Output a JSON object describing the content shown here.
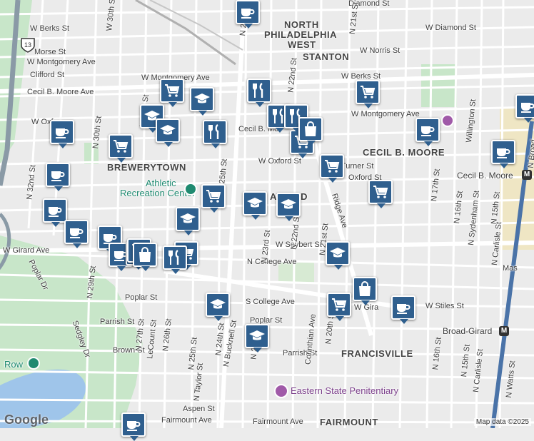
{
  "neighborhoods": [
    "NORTH",
    "PHILADELPHIA",
    "WEST",
    "STANTON",
    "BREWERYTOWN",
    "CECIL B. MOORE",
    "FRANCISVILLE",
    "FAIRMOUNT",
    "AWOOD"
  ],
  "landmarks": {
    "athletic_line1": "Athletic",
    "athletic_line2": "Recreation Center",
    "eastern_state": "Eastern State Penitentiary",
    "cecil_station": "Cecil B. Moore",
    "broad_girard": "Broad-Girard",
    "row": "Row"
  },
  "streets": {
    "w_diamond": "W Diamond St",
    "w_diamond_top": "Diamond St",
    "w_berks": "W Berks St",
    "w_berks_right": "W Berks St",
    "morse": "Morse St",
    "w_montgomery": "W Montgomery Ave",
    "w_montgomery_right": "W Montgomery Ave",
    "clifford": "Clifford St",
    "w_norris": "W Norris St",
    "cecil_moore_ave": "Cecil B. Moore Ave",
    "cecil_short": "Cecil B. Mo",
    "w_oxford": "W Oxford St",
    "w_oxford_left": "W Oxf",
    "turner": "Turner St",
    "oxford_right": "Oxford St",
    "w_girard": "W Girard Ave",
    "w_girard_right": "W Gira",
    "n_college": "N College Ave",
    "s_college": "S College Ave",
    "poplar_left": "Poplar St",
    "poplar_mid": "Poplar St",
    "poplar_dr": "Poplar Dr",
    "parrish_left": "Parrish St",
    "parrish_mid": "Parrish St",
    "brown": "Brown St",
    "aspen": "Aspen St",
    "fairmount_left": "Fairmount Ave",
    "fairmount_right": "Fairmount Ave",
    "w_seybert": "W Seybert St",
    "w_stiles": "W Stiles St",
    "sedgley": "Sedgley Dr",
    "ridge": "Ridge Ave",
    "corinthian": "Corinthian Ave",
    "n_25th": "N 25th St",
    "n_25th_b": "N 25th St",
    "n_24th": "N 24th St",
    "n_23rd": "N 23rd St",
    "n_22nd": "N 22nd St",
    "n_22nd_b": "N 22nd St",
    "n_22nd_c": "N 22nd St",
    "n_21st": "N 21st St",
    "n_20th": "N 20th St",
    "n_30th": "N 30th St",
    "n_29th": "N 29th St",
    "n_27th": "N 27th St",
    "n_26th": "N 26th St",
    "n_32nd": "N 32nd St",
    "n_17th": "N 17th St",
    "n_16th": "N 16th St",
    "n_16th_b": "N 16th St",
    "n_15th": "N 15th St",
    "n_15th_b": "N 15th St",
    "n_sydenham": "N Sydenham St",
    "n_carlisle": "N Carlisle St",
    "n_carlisle_b": "N Carlisle St",
    "n_watts": "N Watts St",
    "n_broad": "N Broad",
    "n_bucknell": "N Bucknell St",
    "n_taylor": "N Taylor St",
    "lecount": "LeCount St",
    "willington": "Willington St",
    "n_21st_top": "N 21st St",
    "n_25th_top": "N 25th St",
    "n_30th_top": "W 30th St",
    "n_29th_top": "N 29th St",
    "mas": "Mas"
  },
  "shield_number": "13",
  "attribution": {
    "google": "Google",
    "map_data": "Map data ©2025"
  },
  "markers": [
    {
      "type": "cafe"
    },
    {
      "type": "cafe"
    },
    {
      "type": "cafe"
    },
    {
      "type": "cafe"
    },
    {
      "type": "cafe"
    },
    {
      "type": "cafe"
    },
    {
      "type": "cafe"
    },
    {
      "type": "cafe"
    },
    {
      "type": "cafe"
    },
    {
      "type": "cafe"
    },
    {
      "type": "cafe"
    },
    {
      "type": "cafe"
    },
    {
      "type": "school"
    },
    {
      "type": "school"
    },
    {
      "type": "school"
    },
    {
      "type": "school"
    },
    {
      "type": "school"
    },
    {
      "type": "school"
    },
    {
      "type": "school"
    },
    {
      "type": "school"
    },
    {
      "type": "school"
    },
    {
      "type": "school"
    },
    {
      "type": "grocery"
    },
    {
      "type": "grocery"
    },
    {
      "type": "grocery"
    },
    {
      "type": "grocery"
    },
    {
      "type": "grocery"
    },
    {
      "type": "grocery"
    },
    {
      "type": "grocery"
    },
    {
      "type": "grocery"
    },
    {
      "type": "grocery"
    },
    {
      "type": "grocery"
    },
    {
      "type": "restaurant"
    },
    {
      "type": "restaurant"
    },
    {
      "type": "restaurant"
    },
    {
      "type": "restaurant"
    },
    {
      "type": "restaurant"
    },
    {
      "type": "shopping"
    },
    {
      "type": "shopping"
    },
    {
      "type": "shopping"
    }
  ],
  "colors": {
    "marker": "#2f5f8e",
    "park": "#c8e6c9",
    "river": "#9fc5ea",
    "highway": "#f3c77a",
    "street": "#ffffff",
    "transit": "#4a73a8"
  }
}
